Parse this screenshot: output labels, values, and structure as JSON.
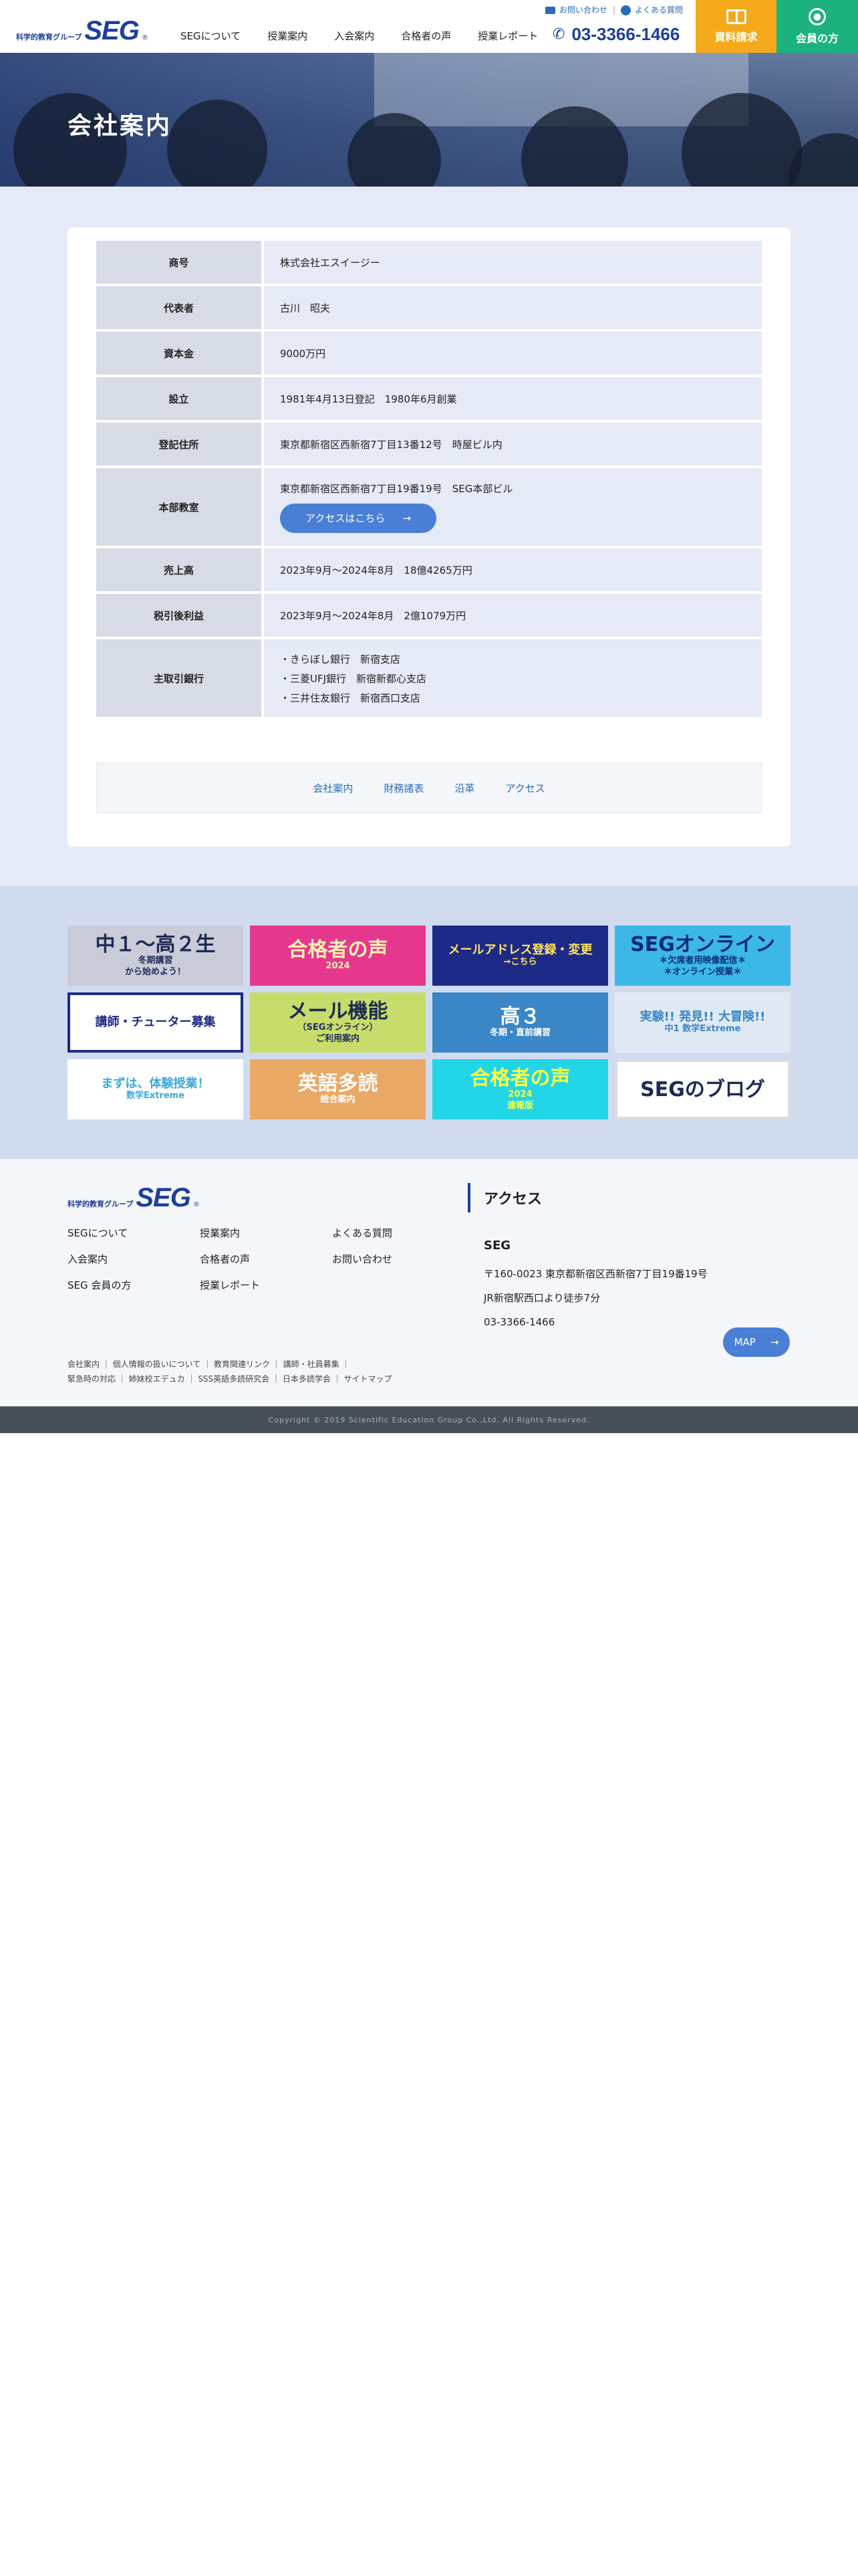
{
  "header": {
    "logo_small": "科学的教育グループ",
    "logo_big": "SEG",
    "logo_reg": "®",
    "contact_link": "お問い合わせ",
    "faq_link": "よくある質問",
    "nav": [
      "SEGについて",
      "授業案内",
      "入会案内",
      "合格者の声",
      "授業レポート"
    ],
    "phone": "03-3366-1466",
    "doc_button": "資料請求",
    "member_button": "会員の方"
  },
  "hero": {
    "title": "会社案内"
  },
  "company_table": [
    {
      "label": "商号",
      "lines": [
        "株式会社エスイージー"
      ]
    },
    {
      "label": "代表者",
      "lines": [
        "古川　昭夫"
      ]
    },
    {
      "label": "資本金",
      "lines": [
        "9000万円"
      ]
    },
    {
      "label": "設立",
      "lines": [
        "1981年4月13日登記　1980年6月創業"
      ]
    },
    {
      "label": "登記住所",
      "lines": [
        "東京都新宿区西新宿7丁目13番12号　時屋ビル内"
      ]
    },
    {
      "label": "本部教室",
      "lines": [
        "東京都新宿区西新宿7丁目19番19号　SEG本部ビル"
      ],
      "button": "アクセスはこちら"
    },
    {
      "label": "売上高",
      "lines": [
        "2023年9月〜2024年8月　18億4265万円"
      ]
    },
    {
      "label": "税引後利益",
      "lines": [
        "2023年9月〜2024年8月　2億1079万円"
      ]
    },
    {
      "label": "主取引銀行",
      "lines": [
        "・きらぼし銀行　新宿支店",
        "・三菱UFJ銀行　新宿新都心支店",
        "・三井住友銀行　新宿西口支店"
      ]
    }
  ],
  "subnav": [
    "会社案内",
    "財務諸表",
    "沿革",
    "アクセス"
  ],
  "banners": [
    {
      "lines": [
        "中１〜高２生",
        "冬期講習",
        "から始めよう！"
      ],
      "bg": "#c9ccd8",
      "fg": "#1f2a55"
    },
    {
      "lines": [
        "合格者の声",
        "2024"
      ],
      "bg": "#e6378f",
      "fg": "#fff3b0"
    },
    {
      "lines": [
        "メールアドレス登録・変更",
        "→こちら"
      ],
      "bg": "#1e2a88",
      "fg": "#ffe560"
    },
    {
      "lines": [
        "SEGオンライン",
        "＊欠席者用映像配信＊",
        "＊オンライン授業＊"
      ],
      "bg": "#3bb8e8",
      "fg": "#0d2a78"
    },
    {
      "lines": [
        "講師・チューター募集"
      ],
      "bg": "#ffffff",
      "fg": "#1e2a88",
      "border": "#1e2a88"
    },
    {
      "lines": [
        "メール機能",
        "（SEGオンライン）",
        "ご利用案内"
      ],
      "bg": "#c7dc6a",
      "fg": "#1e2a55"
    },
    {
      "lines": [
        "高３",
        "冬期・直前講習"
      ],
      "bg": "#3a86c7",
      "fg": "#ffffff"
    },
    {
      "lines": [
        "実験!! 発見!! 大冒険!!",
        "中1 数学Extreme"
      ],
      "bg": "#dfe9f3",
      "fg": "#3a86c7"
    },
    {
      "lines": [
        "まずは、体験授業！",
        "数学Extreme"
      ],
      "bg": "#ffffff",
      "fg": "#3aa9dd"
    },
    {
      "lines": [
        "英語多読",
        "総合案内"
      ],
      "bg": "#e9a864",
      "fg": "#ffffff"
    },
    {
      "lines": [
        "合格者の声",
        "2024",
        "速報版"
      ],
      "bg": "#22d6e8",
      "fg": "#ffff40"
    },
    {
      "lines": [
        "SEGのブログ"
      ],
      "bg": "#ffffff",
      "fg": "#1e2a55",
      "border": "#dddddd"
    }
  ],
  "footer": {
    "links": [
      "SEGについて",
      "授業案内",
      "よくある質問",
      "入会案内",
      "合格者の声",
      "お問い合わせ",
      "SEG 会員の方",
      "授業レポート"
    ],
    "bottom_links": [
      "会社案内",
      "個人情報の扱いについて",
      "教育関連リンク",
      "講師・社員募集",
      "緊急時の対応",
      "姉妹校エデュカ",
      "SSS英語多読研究会",
      "日本多読学会",
      "サイトマップ"
    ],
    "access_title": "アクセス",
    "access_name": "SEG",
    "access_address": "〒160-0023 東京都新宿区西新宿7丁目19番19号",
    "access_station": "JR新宿駅西口より徒歩7分",
    "access_phone": "03-3366-1466",
    "map_button": "MAP",
    "copyright": "Copyright © 2019 Scientific Education Group Co.,Ltd. All Rights Reserved."
  },
  "colors": {
    "brand": "#1e3f9a",
    "accent": "#4a7fd6",
    "doc": "#f3a91a",
    "member": "#1bb27d"
  }
}
